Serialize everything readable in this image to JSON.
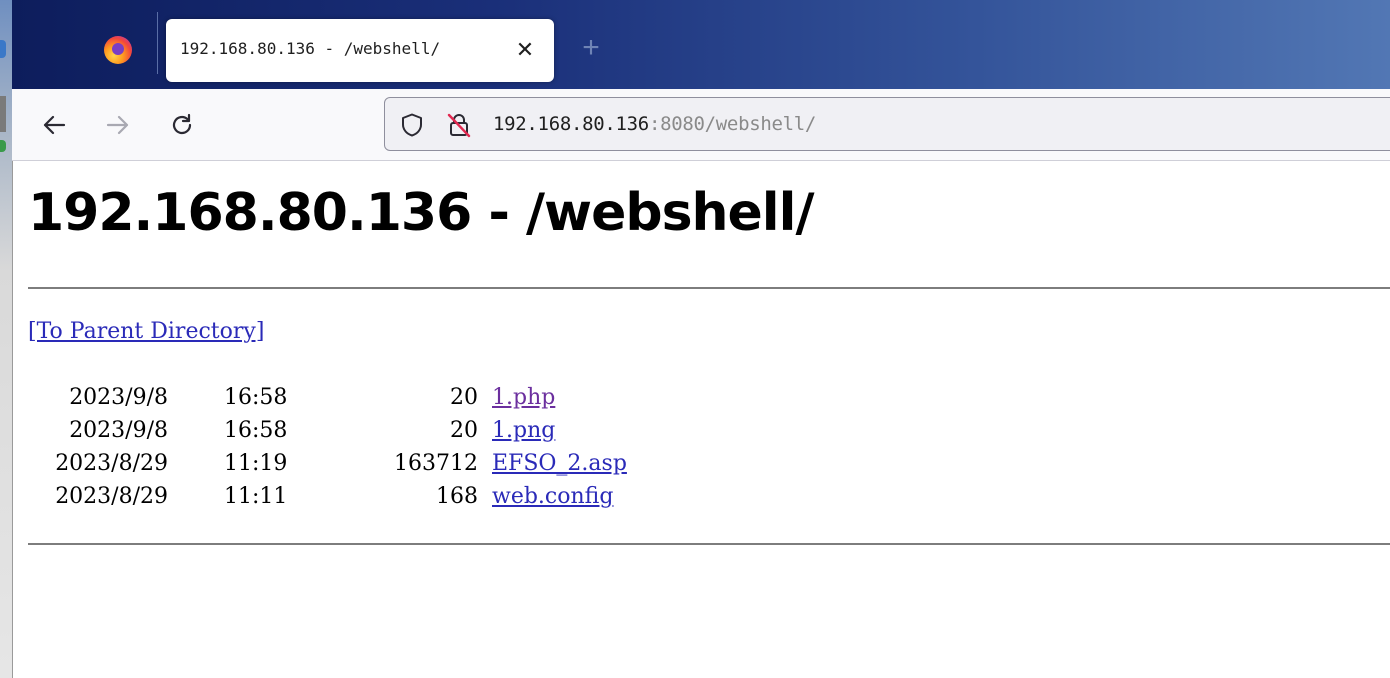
{
  "browser": {
    "tab": {
      "title": "192.168.80.136 - /webshell/",
      "close_glyph": "✕"
    },
    "new_tab_glyph": "+",
    "urlbar": {
      "host": "192.168.80.136",
      "rest": ":8080/webshell/"
    },
    "icons": [
      "firefox-logo",
      "back-arrow-icon",
      "forward-arrow-icon",
      "reload-icon",
      "shield-icon",
      "insecure-lock-icon"
    ]
  },
  "page": {
    "title": "192.168.80.136 - /webshell/",
    "parent_link": "[To Parent Directory]",
    "files": [
      {
        "date": "2023/9/8",
        "time": "16:58",
        "size": "20",
        "name": "1.php",
        "visited": true
      },
      {
        "date": "2023/9/8",
        "time": "16:58",
        "size": "20",
        "name": "1.png",
        "visited": false
      },
      {
        "date": "2023/8/29",
        "time": "11:19",
        "size": "163712",
        "name": "EFSO_2.asp",
        "visited": false
      },
      {
        "date": "2023/8/29",
        "time": "11:11",
        "size": "168",
        "name": "web.config",
        "visited": false
      }
    ]
  },
  "colors": {
    "link": "#2a2ab8",
    "visited_link": "#6b2f9e",
    "tabstrip_dark": "#0d1d5c",
    "tabstrip_light": "#5277b4"
  }
}
